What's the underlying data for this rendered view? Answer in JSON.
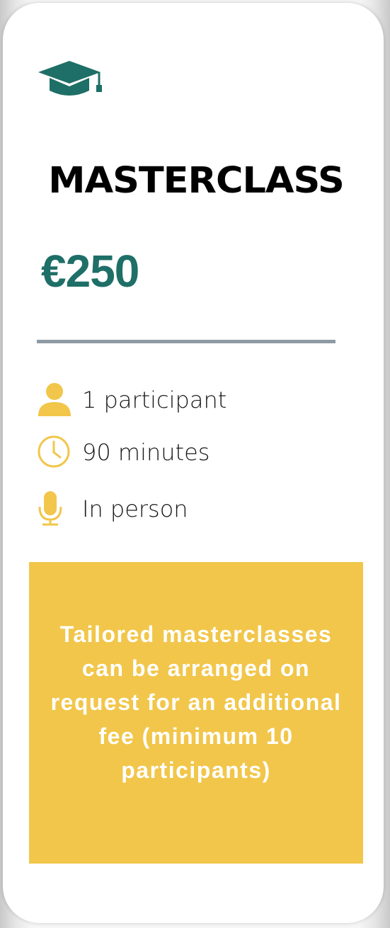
{
  "card": {
    "icon": "graduation-cap-icon",
    "title": "MASTERCLASS",
    "price": "€250",
    "features": [
      {
        "icon": "person-icon",
        "label": "1 participant"
      },
      {
        "icon": "clock-icon",
        "label": "90 minutes"
      },
      {
        "icon": "microphone-icon",
        "label": "In person"
      }
    ],
    "note": "Tailored masterclasses can be arranged on request for an additional fee (minimum 10 participants)"
  },
  "colors": {
    "accent_teal": "#1e6f67",
    "icon_yellow": "#f1c64a",
    "note_background": "#f1c64a",
    "divider": "#8e9aa3"
  }
}
